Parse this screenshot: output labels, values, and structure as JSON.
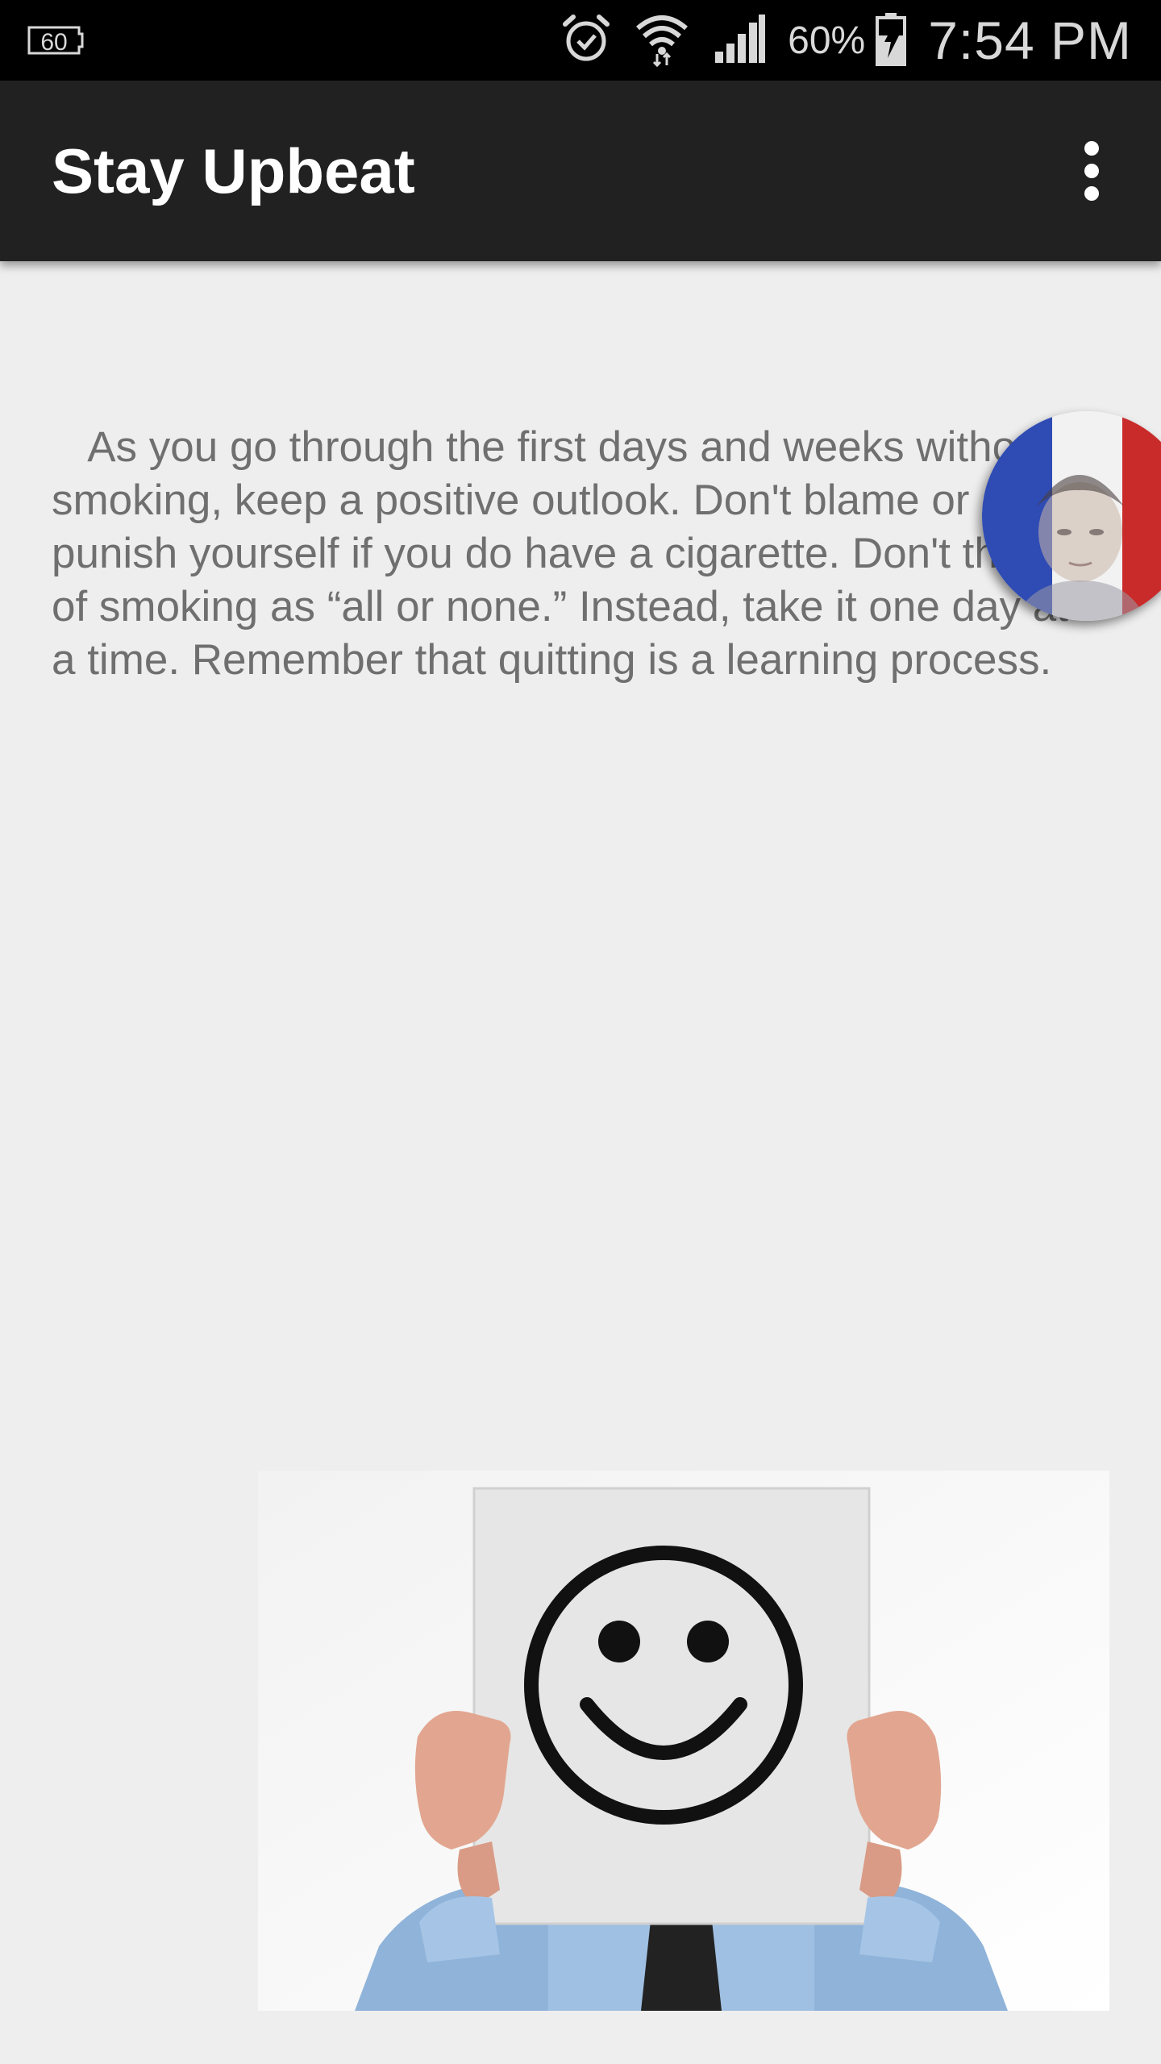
{
  "status_bar": {
    "notification_icon": "data-saver-60-icon",
    "notification_label": "60",
    "icons": [
      "alarm-icon",
      "wifi-icon",
      "cell-signal-icon",
      "battery-charging-icon"
    ],
    "battery_percent": "60%",
    "time": "7:54 PM"
  },
  "app_bar": {
    "title": "Stay Upbeat",
    "overflow_icon": "more-vert-icon",
    "background": "#212121"
  },
  "content": {
    "body_text": "   As you go through the first days and weeks without smoking, keep a positive outlook. Don't blame or punish yourself if you do have a cigarette. Don't think of smoking as “all or none.” Instead, take it one day at a time. Remember that quitting is a learning process.",
    "image": "person-holding-smiley-face-sign"
  },
  "floating_chat_head": {
    "image": "avatar-with-french-flag",
    "colors": [
      "#2f4bb4",
      "#ffffff",
      "#c92a2a"
    ]
  },
  "colors": {
    "page_background": "#eeeeee",
    "text": "#6f6f6f",
    "status_bar": "#000000"
  }
}
